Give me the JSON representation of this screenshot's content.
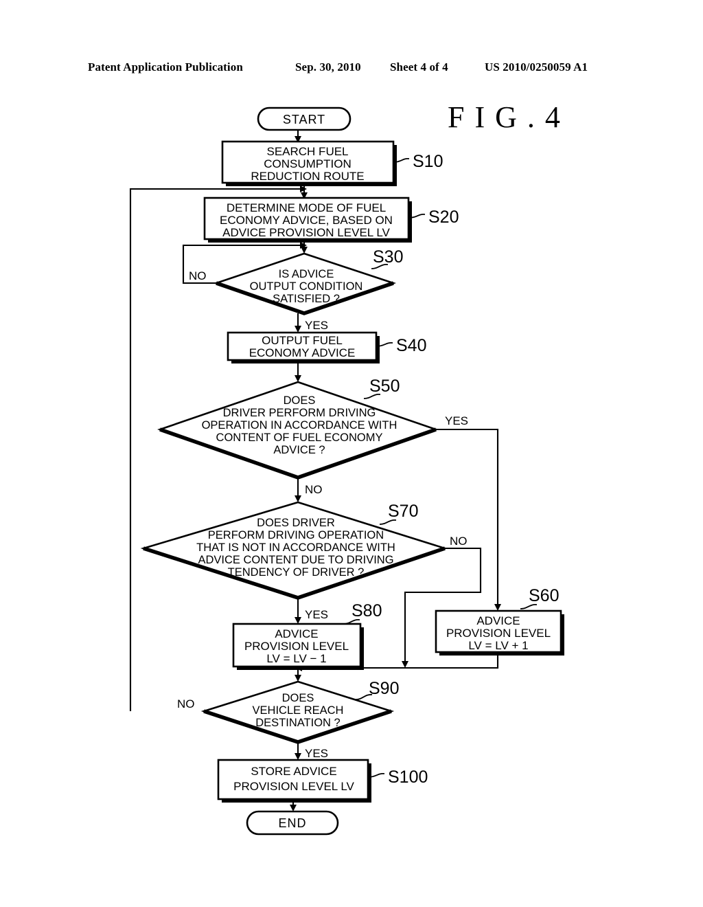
{
  "header": {
    "publication": "Patent Application Publication",
    "date": "Sep. 30, 2010",
    "sheet": "Sheet 4 of 4",
    "number": "US 2010/0250059 A1"
  },
  "figure": {
    "title": "F I G . 4"
  },
  "flowchart": {
    "start_label": "START",
    "end_label": "END",
    "yes_label": "YES",
    "no_label": "NO",
    "steps": {
      "s10": {
        "tag": "S10",
        "lines": [
          "SEARCH FUEL",
          "CONSUMPTION",
          "REDUCTION ROUTE"
        ]
      },
      "s20": {
        "tag": "S20",
        "lines": [
          "DETERMINE MODE OF FUEL",
          "ECONOMY ADVICE, BASED ON",
          "ADVICE PROVISION LEVEL LV"
        ]
      },
      "s30": {
        "tag": "S30",
        "lines": [
          "IS ADVICE",
          "OUTPUT CONDITION",
          "SATISFIED ?"
        ],
        "yes": "YES",
        "no": "NO"
      },
      "s40": {
        "tag": "S40",
        "lines": [
          "OUTPUT FUEL",
          "ECONOMY ADVICE"
        ]
      },
      "s50": {
        "tag": "S50",
        "lines": [
          "DOES",
          "DRIVER PERFORM DRIVING",
          "OPERATION IN ACCORDANCE WITH",
          "CONTENT OF FUEL ECONOMY",
          "ADVICE ?"
        ],
        "yes": "YES",
        "no": "NO"
      },
      "s60": {
        "tag": "S60",
        "lines": [
          "ADVICE",
          "PROVISION LEVEL",
          "LV = LV + 1"
        ]
      },
      "s70": {
        "tag": "S70",
        "lines": [
          "DOES DRIVER",
          "PERFORM DRIVING OPERATION",
          "THAT IS NOT IN ACCORDANCE WITH",
          "ADVICE CONTENT DUE TO DRIVING",
          "TENDENCY OF DRIVER ?"
        ],
        "yes": "YES",
        "no": "NO"
      },
      "s80": {
        "tag": "S80",
        "lines": [
          "ADVICE",
          "PROVISION LEVEL",
          "LV = LV − 1"
        ]
      },
      "s90": {
        "tag": "S90",
        "lines": [
          "DOES",
          "VEHICLE REACH",
          "DESTINATION ?"
        ],
        "yes": "YES",
        "no": "NO"
      },
      "s100": {
        "tag": "S100",
        "lines": [
          "STORE ADVICE",
          "PROVISION LEVEL LV"
        ]
      }
    }
  },
  "colors": {
    "ink": "#000000",
    "paper": "#ffffff"
  }
}
